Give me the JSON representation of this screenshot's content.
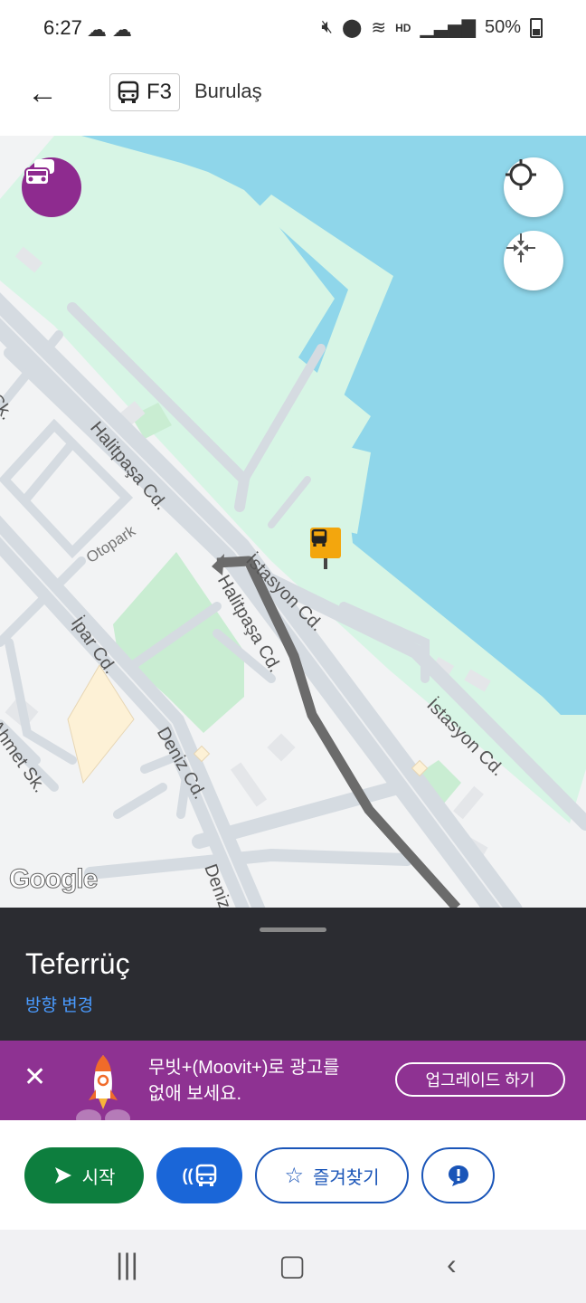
{
  "status_bar": {
    "time": "6:27",
    "battery": "50%",
    "network": "HD"
  },
  "header": {
    "route_number": "F3",
    "agency": "Burulaş"
  },
  "map": {
    "labels": {
      "halitpasa_1": "Halitpaşa Cd.",
      "halitpasa_2": "Halitpaşa Cd.",
      "istasyon_1": "İstasyon Cd.",
      "istasyon_2": "İstasyon Cd.",
      "otopark": "Otopark",
      "ipar": "İpar Cd.",
      "deniz_1": "Deniz Cd.",
      "deniz_2": "Deniz",
      "ahmet": "Ahmet Sk.",
      "sk": "Sk."
    },
    "attribution": "Google",
    "colors": {
      "water": "#8fd6ea",
      "park": "#cdf3e0",
      "route": "#6b6b6b",
      "stop": "#f3a60d"
    }
  },
  "panel": {
    "stop_name": "Teferrüç",
    "change_direction": "방향 변경"
  },
  "promo": {
    "line1": "무빗+(Moovit+)로 광고를",
    "line2": "없애 보세요.",
    "upgrade": "업그레이드 하기"
  },
  "actions": {
    "start": "시작",
    "favorite": "즐겨찾기"
  }
}
